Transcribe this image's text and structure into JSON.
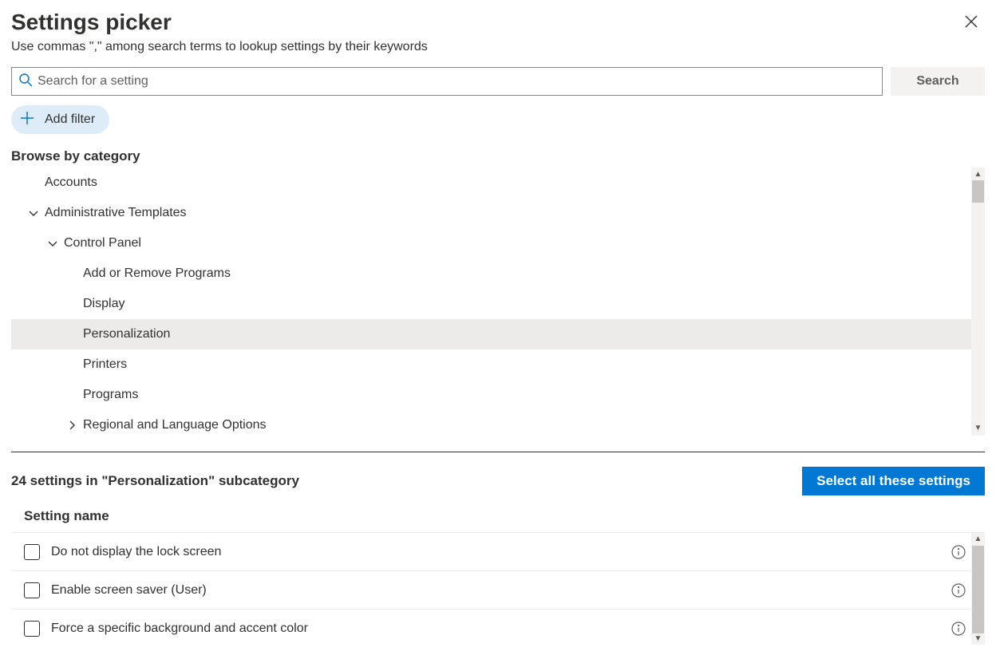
{
  "header": {
    "title": "Settings picker",
    "subtitle": "Use commas \",\" among search terms to lookup settings by their keywords"
  },
  "search": {
    "placeholder": "Search for a setting",
    "button": "Search"
  },
  "filter": {
    "add": "Add filter"
  },
  "browse": {
    "label": "Browse by category"
  },
  "tree": {
    "accounts": "Accounts",
    "adminTemplates": "Administrative Templates",
    "controlPanel": "Control Panel",
    "addRemove": "Add or Remove Programs",
    "display": "Display",
    "personalization": "Personalization",
    "printers": "Printers",
    "programs": "Programs",
    "regional": "Regional and Language Options"
  },
  "results": {
    "count_text": "24 settings in \"Personalization\" subcategory",
    "select_all": "Select all these settings",
    "column_header": "Setting name",
    "rows": [
      "Do not display the lock screen",
      "Enable screen saver (User)",
      "Force a specific background and accent color"
    ]
  }
}
